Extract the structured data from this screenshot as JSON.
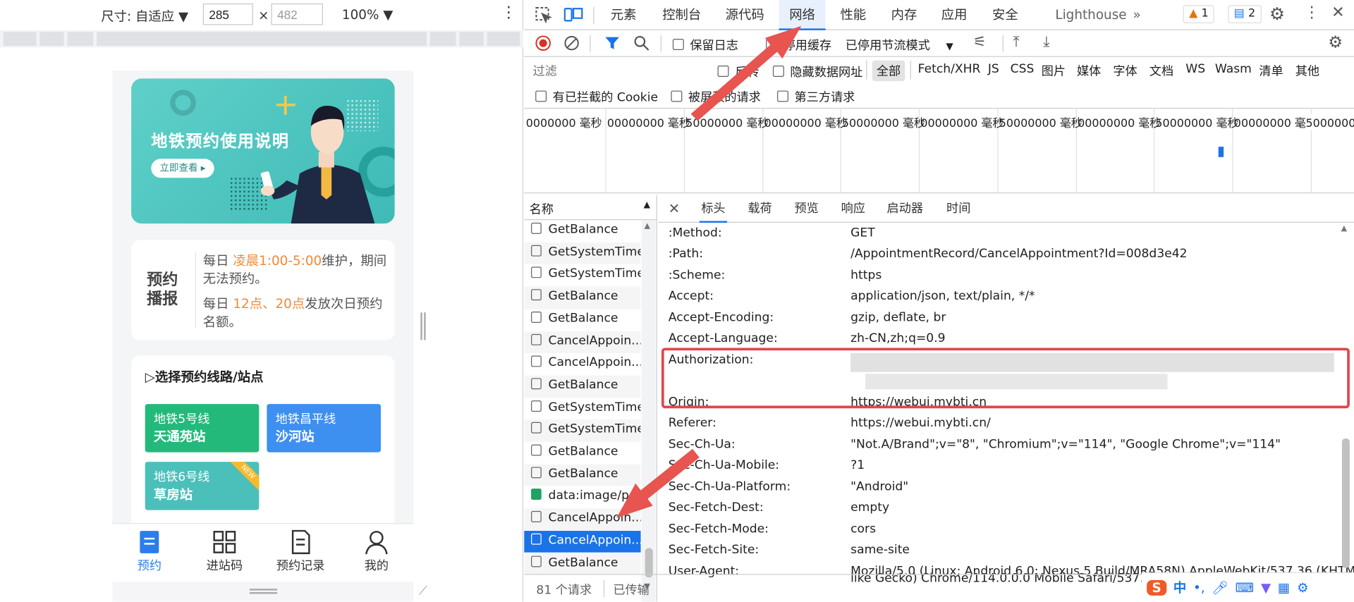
{
  "device_toolbar": {
    "size_label": "尺寸: 自适应",
    "width": "285",
    "height": "482",
    "times": "×",
    "zoom": "100%"
  },
  "phone": {
    "banner": {
      "title": "地铁预约使用说明",
      "button": "立即查看"
    },
    "notice": {
      "heading": "预约播报",
      "line1_prefix": "每日",
      "line1_highlight": "凌晨1:00-5:00",
      "line1_suffix": "维护，期间无法预约。",
      "line2_prefix": "每日",
      "line2_highlight": "12点、20点",
      "line2_suffix": "发放次日预约名额。"
    },
    "lines_title": "选择预约线路/站点",
    "cards": [
      {
        "line": "地铁5号线",
        "station": "天通苑站",
        "color": "#23b97a"
      },
      {
        "line": "地铁昌平线",
        "station": "沙河站",
        "color": "#3d8ff0"
      },
      {
        "line": "地铁6号线",
        "station": "草房站",
        "color": "#4bc0bb",
        "badge": "NEW"
      }
    ],
    "tabs": [
      {
        "label": "预约",
        "active": true
      },
      {
        "label": "进站码"
      },
      {
        "label": "预约记录"
      },
      {
        "label": "我的"
      }
    ]
  },
  "devtools": {
    "tabs": [
      "元素",
      "控制台",
      "源代码",
      "网络",
      "性能",
      "内存",
      "应用",
      "安全",
      "Lighthouse"
    ],
    "active_tab": "网络",
    "warnings": "1",
    "messages": "2",
    "toolbar": {
      "preserve_log": "保留日志",
      "disable_cache": "停用缓存",
      "throttle": "已停用节流模式"
    },
    "filter": {
      "placeholder": "过滤",
      "invert": "反转",
      "hide_data_urls": "隐藏数据网址",
      "types": [
        "全部",
        "Fetch/XHR",
        "JS",
        "CSS",
        "图片",
        "媒体",
        "字体",
        "文档",
        "WS",
        "Wasm",
        "清单",
        "其他"
      ],
      "blocked_cookies": "有已拦截的 Cookie",
      "blocked_requests": "被屏蔽的请求",
      "third_party": "第三方请求"
    },
    "timeline_labels": [
      "0000000 毫秒",
      "00000000 毫秒",
      "50000000 毫秒",
      "00000000 毫秒",
      "50000000 毫秒",
      "00000000 毫秒",
      "50000000 毫秒",
      "00000000 毫秒",
      "50000000 毫秒",
      "00000000 毫秒",
      "50000000 毫秒"
    ],
    "name_header": "名称",
    "requests": [
      "GetBalance",
      "GetSystemTime",
      "GetSystemTime",
      "GetBalance",
      "GetBalance",
      "CancelAppoin...",
      "CancelAppoin...",
      "GetBalance",
      "GetSystemTime",
      "GetSystemTime",
      "GetBalance",
      "GetBalance",
      "data:image/p...",
      "CancelAppoin...",
      "CancelAppoin...",
      "GetBalance"
    ],
    "selected_index": 14,
    "status": {
      "requests": "81 个请求",
      "transferred": "已传输"
    },
    "detail_tabs": [
      "标头",
      "载荷",
      "预览",
      "响应",
      "启动器",
      "时间"
    ],
    "headers": [
      {
        "name": ":Method:",
        "value": "GET"
      },
      {
        "name": ":Path:",
        "value": "/AppointmentRecord/CancelAppointment?Id=008d3e42"
      },
      {
        "name": ":Scheme:",
        "value": "https"
      },
      {
        "name": "Accept:",
        "value": "application/json, text/plain, */*"
      },
      {
        "name": "Accept-Encoding:",
        "value": "gzip, deflate, br"
      },
      {
        "name": "Accept-Language:",
        "value": "zh-CN,zh;q=0.9"
      },
      {
        "name": "Authorization:",
        "value": ""
      },
      {
        "name": "Origin:",
        "value": "https://webui.mybti.cn"
      },
      {
        "name": "Referer:",
        "value": "https://webui.mybti.cn/"
      },
      {
        "name": "Sec-Ch-Ua:",
        "value": "\"Not.A/Brand\";v=\"8\", \"Chromium\";v=\"114\", \"Google Chrome\";v=\"114\""
      },
      {
        "name": "Sec-Ch-Ua-Mobile:",
        "value": "?1"
      },
      {
        "name": "Sec-Ch-Ua-Platform:",
        "value": "\"Android\""
      },
      {
        "name": "Sec-Fetch-Dest:",
        "value": "empty"
      },
      {
        "name": "Sec-Fetch-Mode:",
        "value": "cors"
      },
      {
        "name": "Sec-Fetch-Site:",
        "value": "same-site"
      },
      {
        "name": "User-Agent:",
        "value": "Mozilla/5.0 (Linux; Android 6.0; Nexus 5 Build/MRA58N) AppleWebKit/537.36 (KHTML,"
      }
    ],
    "user_agent_cont": "like Gecko) Chrome/114.0.0.0 Mobile Safari/537.36"
  },
  "ime": {
    "label": "中"
  },
  "colors": {
    "accent": "#1a73e8",
    "annotation": "#e0454b",
    "orange": "#f08a3a"
  }
}
